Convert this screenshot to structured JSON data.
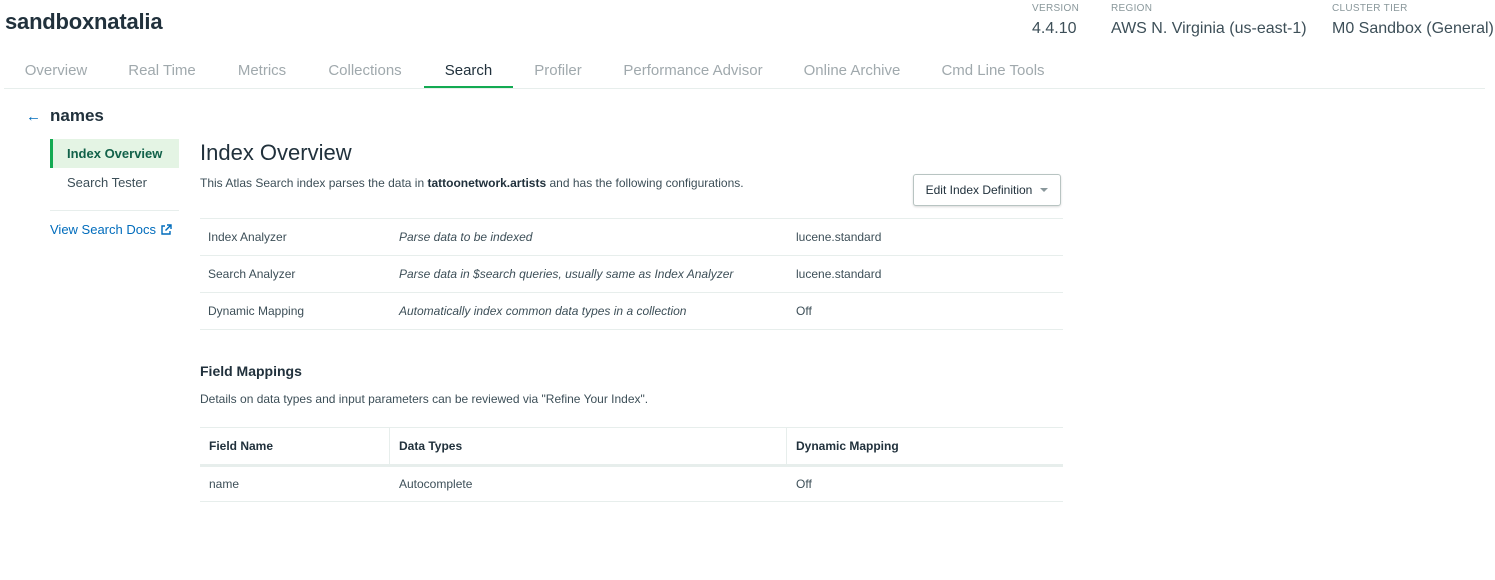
{
  "cluster": {
    "name": "sandboxnatalia"
  },
  "meta": {
    "version_label": "VERSION",
    "version": "4.4.10",
    "region_label": "REGION",
    "region": "AWS N. Virginia (us-east-1)",
    "tier_label": "CLUSTER TIER",
    "tier": "M0 Sandbox (General)"
  },
  "tabs": [
    {
      "label": "Overview"
    },
    {
      "label": "Real Time"
    },
    {
      "label": "Metrics"
    },
    {
      "label": "Collections"
    },
    {
      "label": "Search",
      "active": true
    },
    {
      "label": "Profiler"
    },
    {
      "label": "Performance Advisor"
    },
    {
      "label": "Online Archive"
    },
    {
      "label": "Cmd Line Tools"
    }
  ],
  "index": {
    "back_icon": "arrow-left-icon",
    "name": "names"
  },
  "sidebar": {
    "items": [
      {
        "label": "Index Overview",
        "active": true
      },
      {
        "label": "Search Tester"
      }
    ],
    "docs_link": "View Search Docs",
    "docs_icon": "external-link-icon"
  },
  "overview": {
    "title": "Index Overview",
    "desc_prefix": "This Atlas Search index parses the data in ",
    "desc_namespace": "tattoonetwork.artists",
    "desc_suffix": " and has the following configurations.",
    "edit_button": "Edit Index Definition",
    "config": [
      {
        "name": "Index Analyzer",
        "description": "Parse data to be indexed",
        "value": "lucene.standard"
      },
      {
        "name": "Search Analyzer",
        "description": "Parse data in $search queries, usually same as Index Analyzer",
        "value": "lucene.standard"
      },
      {
        "name": "Dynamic Mapping",
        "description": "Automatically index common data types in a collection",
        "value": "Off"
      }
    ]
  },
  "field_mappings": {
    "title": "Field Mappings",
    "description": "Details on data types and input parameters can be reviewed via \"Refine Your Index\".",
    "headers": [
      "Field Name",
      "Data Types",
      "Dynamic Mapping"
    ],
    "rows": [
      {
        "field": "name",
        "types": "Autocomplete",
        "dynamic": "Off"
      }
    ]
  },
  "colors": {
    "accent": "#13aa52",
    "link": "#006cbc"
  }
}
